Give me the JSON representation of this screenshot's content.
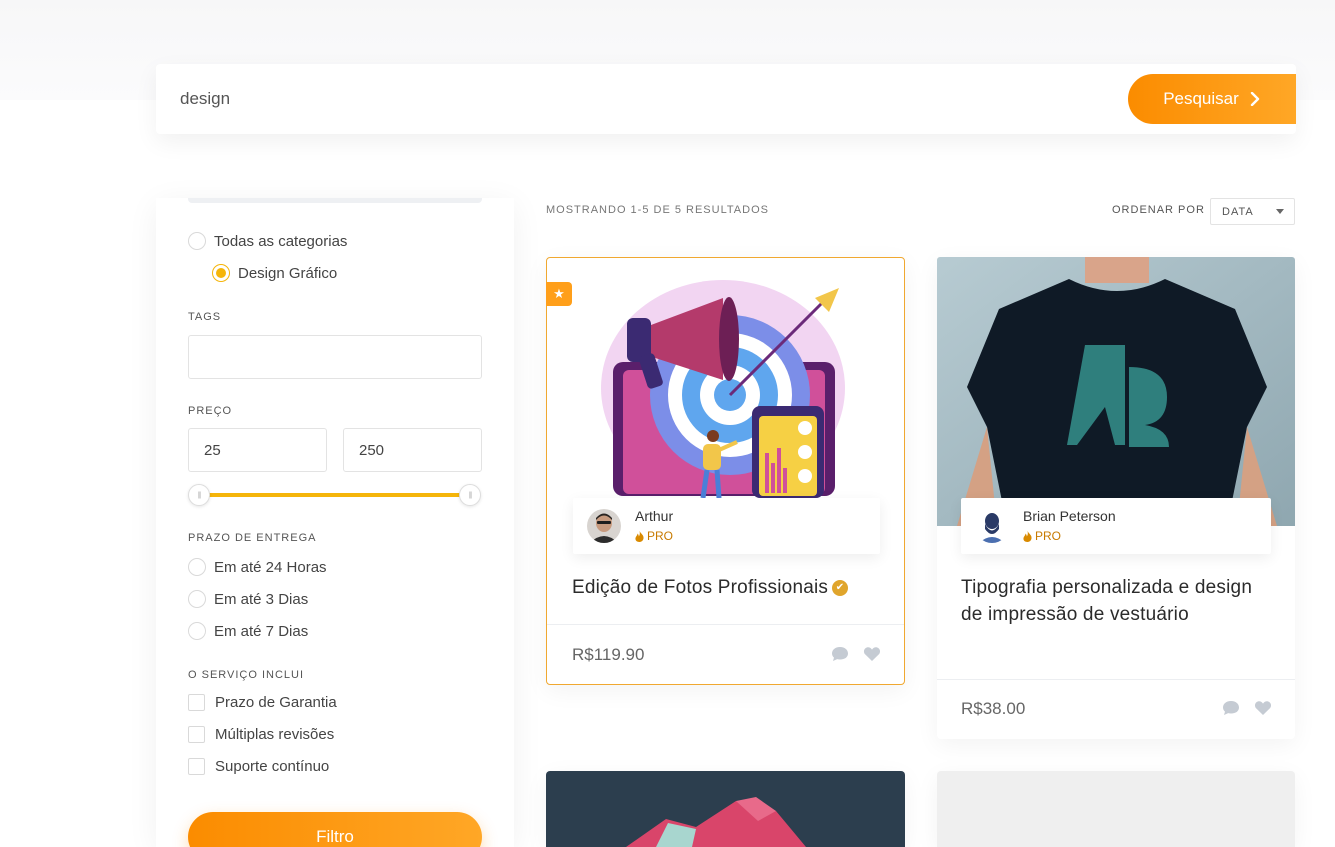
{
  "search": {
    "value": "design",
    "button_label": "Pesquisar"
  },
  "sidebar": {
    "categories": [
      {
        "label": "Todas as categorias",
        "checked": false
      },
      {
        "label": "Design Gráfico",
        "checked": true
      }
    ],
    "tags_label": "TAGS",
    "tags_value": "",
    "price_label": "PREÇO",
    "price_min": "25",
    "price_max": "250",
    "delivery_label": "PRAZO DE ENTREGA",
    "delivery_options": [
      "Em até 24 Horas",
      "Em até 3 Dias",
      "Em até 7 Dias"
    ],
    "includes_label": "O SERVIÇO INCLUI",
    "includes_options": [
      "Prazo de Garantia",
      "Múltiplas revisões",
      "Suporte contínuo"
    ],
    "filter_button": "Filtro"
  },
  "results": {
    "count_text": "MOSTRANDO 1-5 DE 5 RESULTADOS",
    "sort_label": "ORDENAR POR",
    "sort_value": "DATA"
  },
  "cards": [
    {
      "seller": "Arthur",
      "badge": "PRO",
      "title": "Edição de Fotos Profissionais",
      "price": "R$119.90",
      "featured": true,
      "verified": true
    },
    {
      "seller": "Brian Peterson",
      "badge": "PRO",
      "title": "Tipografia personalizada e design de impressão de vestuário",
      "price": "R$38.00",
      "featured": false,
      "verified": false
    }
  ],
  "colors": {
    "accent": "#fb8c00",
    "accent_light": "#ffa726",
    "slider": "#f5b50a",
    "pro": "#c77a00"
  }
}
